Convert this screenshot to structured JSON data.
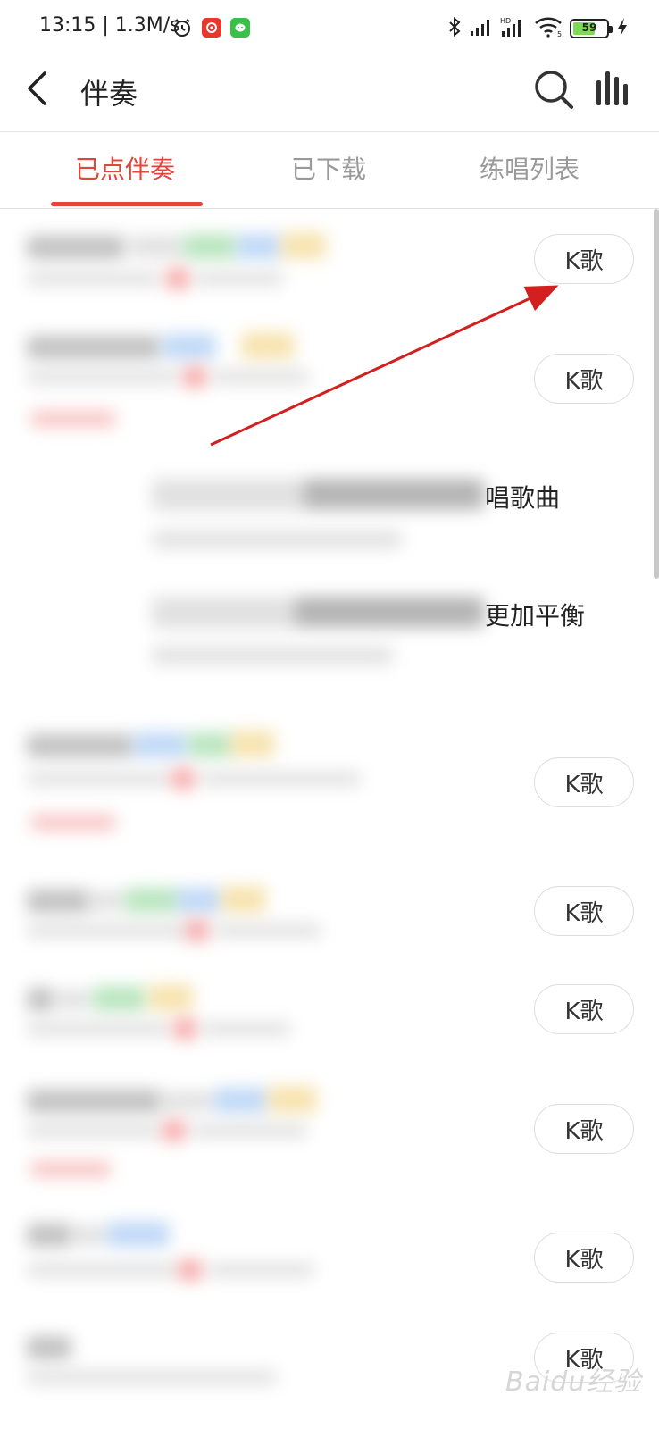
{
  "status_bar": {
    "time": "13:15 | 1.3M/s",
    "battery": "59",
    "icons": [
      "alarm-icon",
      "netease-app-icon",
      "wechat-app-icon",
      "bluetooth-icon",
      "signal-icon",
      "hd-signal-icon",
      "wifi-icon",
      "battery-icon",
      "charging-icon"
    ]
  },
  "header": {
    "title": "伴奏",
    "icons": [
      "back-arrow-icon",
      "search-icon",
      "equalizer-bars-icon"
    ]
  },
  "tabs": [
    {
      "label": "已点伴奏",
      "active": true
    },
    {
      "label": "已下载",
      "active": false
    },
    {
      "label": "练唱列表",
      "active": false
    }
  ],
  "list": {
    "k_button_label": "K歌",
    "partial_texts": [
      "唱歌曲",
      "更加平衡"
    ]
  },
  "colors": {
    "accent": "#e0463a",
    "annotation_arrow": "#d22020"
  },
  "watermark": "Baidu经验"
}
